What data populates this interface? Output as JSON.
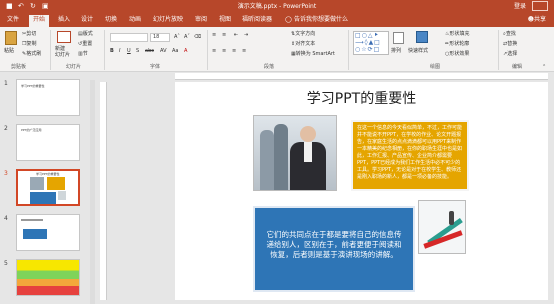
{
  "titlebar": {
    "doc_title": "演示文稿.pptx - PowerPoint",
    "login": "登录"
  },
  "menu": {
    "items": [
      "文件",
      "开始",
      "插入",
      "设计",
      "切换",
      "动画",
      "幻灯片放映",
      "审阅",
      "视图",
      "福昕阅读器"
    ],
    "active": "开始",
    "tellme": "告诉我你想要做什么",
    "share": "共享"
  },
  "ribbon": {
    "clipboard": {
      "paste": "粘贴",
      "cut": "剪切",
      "copy": "复制",
      "format_painter": "格式刷",
      "label": "剪贴板"
    },
    "slides": {
      "new_slide": "新建\n幻灯片",
      "layout": "版式",
      "reset": "重置",
      "section": "节",
      "label": "幻灯片"
    },
    "font": {
      "name": "",
      "size": "18",
      "label": "字体"
    },
    "paragraph": {
      "text_direction": "文字方向",
      "align_text": "对齐文本",
      "smartart": "转换为 SmartArt",
      "label": "段落"
    },
    "drawing": {
      "arrange": "排列",
      "quick_styles": "快速样式",
      "shape_fill": "形状填充",
      "shape_outline": "形状轮廓",
      "shape_effects": "形状效果",
      "label": "绘图"
    },
    "editing": {
      "find": "查找",
      "replace": "替换",
      "select": "选择",
      "label": "编辑"
    }
  },
  "thumbnails": [
    {
      "num": "1",
      "text": "学习PPT的重要性"
    },
    {
      "num": "2",
      "text": "PPT的广泛应用"
    },
    {
      "num": "3",
      "text": "学习PPT的重要性"
    },
    {
      "num": "4",
      "text": ""
    },
    {
      "num": "5",
      "text": ""
    }
  ],
  "selected_slide": 3,
  "slide": {
    "title": "学习PPT的重要性",
    "yellow_text": "在这一个信息的今天看似简单，不过，工作可能并不能说不开PPT，在学校的作业、论文开题报告，在家庭生活的点点滴滴都可以用PPT来制作一本精美的纪念相册，在你的职场生涯中也是如此，工作汇报、产品宣传、企业简介都需要PPT，PPT已经成为我们工作生活中必不可少的工具。学习PPT，无论是对于在校学生、教师还是刚入职场的新人，都是一项必备的技能。",
    "blue_text": "它们的共同点在于都是要将自己的信息传递给别人，区别在于，前者更便于阅读和恢复，后者则是基于演讲现场的讲解。"
  },
  "colors": {
    "accent": "#b7472a",
    "yellow_box": "#e5a500",
    "blue_box": "#2e75b6",
    "selection": "#d24726"
  }
}
